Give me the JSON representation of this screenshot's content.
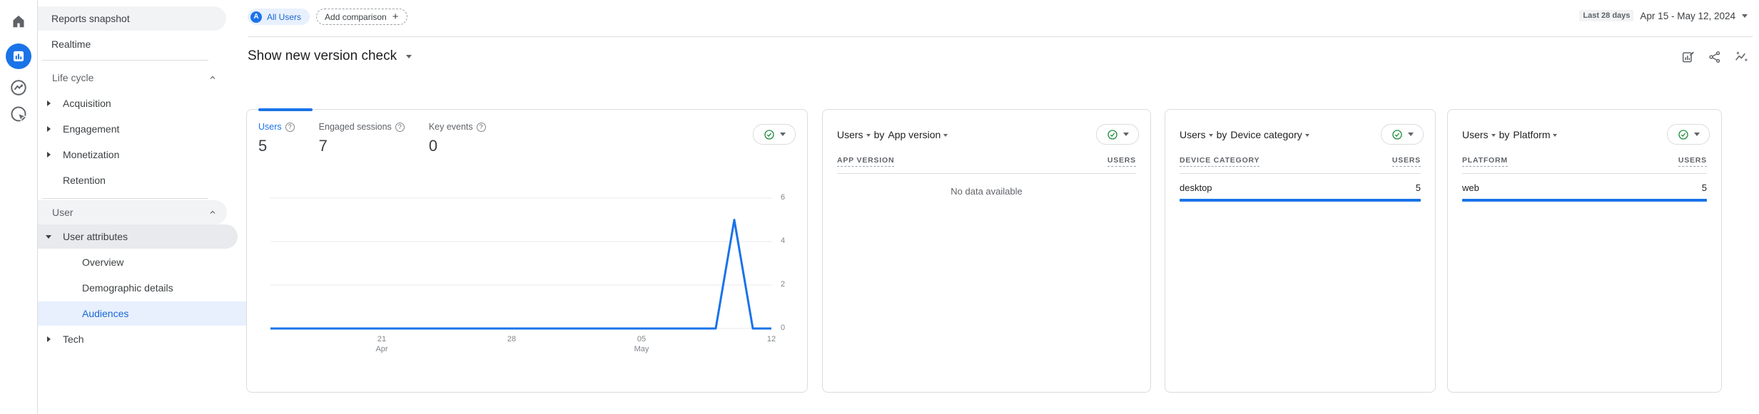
{
  "ui": {
    "help_glyph": "?"
  },
  "colors": {
    "accent_blue": "#1a73e8",
    "link_blue": "#1967d2",
    "chip_bg": "#e8f0fe",
    "check_green": "#1e8e3e",
    "text_primary": "#202124",
    "text_secondary": "#5f6368",
    "border": "#dadce0"
  },
  "sidebar": {
    "reports_snapshot": "Reports snapshot",
    "realtime": "Realtime",
    "life_cycle": {
      "title": "Life cycle",
      "acquisition": "Acquisition",
      "engagement": "Engagement",
      "monetization": "Monetization",
      "retention": "Retention"
    },
    "user": {
      "title": "User",
      "user_attributes": "User attributes",
      "overview": "Overview",
      "demographic_details": "Demographic details",
      "audiences": "Audiences",
      "tech": "Tech"
    }
  },
  "header": {
    "segment_chip": {
      "avatar": "A",
      "label": "All Users"
    },
    "add_comparison": "Add comparison",
    "plus": "+",
    "title": "Show new version check",
    "date_range": {
      "preset": "Last 28 days",
      "range": "Apr 15 - May 12, 2024"
    }
  },
  "overview_card": {
    "tabs": [
      {
        "label": "Users",
        "value": "5"
      },
      {
        "label": "Engaged sessions",
        "value": "7"
      },
      {
        "label": "Key events",
        "value": "0"
      }
    ]
  },
  "chart_data": {
    "type": "line",
    "title": "Users over time (Apr 15 - May 12, 2024)",
    "x_unit": "day",
    "x_start": "Apr 15, 2024",
    "x_end": "May 12, 2024",
    "series": [
      {
        "name": "Users",
        "color": "#1a73e8",
        "values": [
          0,
          0,
          0,
          0,
          0,
          0,
          0,
          0,
          0,
          0,
          0,
          0,
          0,
          0,
          0,
          0,
          0,
          0,
          0,
          0,
          0,
          0,
          0,
          0,
          0,
          5,
          0,
          0
        ]
      }
    ],
    "x_tick_labels": [
      {
        "line1": "21",
        "line2": "Apr",
        "day_index": 6
      },
      {
        "line1": "28",
        "line2": "",
        "day_index": 13
      },
      {
        "line1": "05",
        "line2": "May",
        "day_index": 20
      },
      {
        "line1": "12",
        "line2": "",
        "day_index": 27
      }
    ],
    "y_ticks": [
      0,
      2,
      4,
      6
    ],
    "ylim": [
      0,
      6.4
    ],
    "grid": "horizontal",
    "legend": "none"
  },
  "breakdown_cards": [
    {
      "metric": "Users",
      "by": "by",
      "dimension": "App version",
      "col_dim": "APP VERSION",
      "col_metric": "USERS",
      "empty": "No data available",
      "rows": []
    },
    {
      "metric": "Users",
      "by": "by",
      "dimension": "Device category",
      "col_dim": "DEVICE CATEGORY",
      "col_metric": "USERS",
      "rows": [
        {
          "dim": "desktop",
          "value": "5",
          "bar_pct": 100
        }
      ]
    },
    {
      "metric": "Users",
      "by": "by",
      "dimension": "Platform",
      "col_dim": "PLATFORM",
      "col_metric": "USERS",
      "rows": [
        {
          "dim": "web",
          "value": "5",
          "bar_pct": 100
        }
      ]
    }
  ]
}
